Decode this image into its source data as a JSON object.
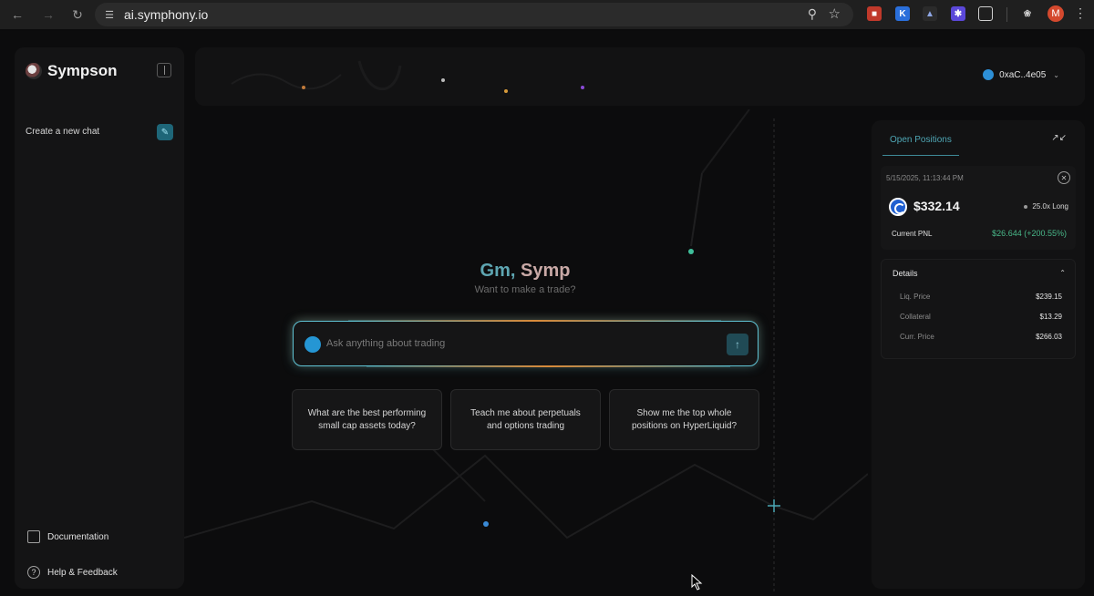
{
  "browser": {
    "url": "ai.symphony.io",
    "profile_initial": "M"
  },
  "sidebar": {
    "brand": "Sympson",
    "new_chat": "Create a new chat",
    "links": [
      {
        "label": "Documentation",
        "icon": "document-icon"
      },
      {
        "label": "Help & Feedback",
        "icon": "help-icon"
      }
    ]
  },
  "header": {
    "wallet_address": "0xaC..4e05"
  },
  "main": {
    "greeting_part1": "Gm,",
    "greeting_part2": "Symp",
    "subtitle": "Want to make a trade?",
    "input_placeholder": "Ask anything about trading",
    "suggestions": [
      "What are the best performing small cap assets today?",
      "Teach me about perpetuals and options trading",
      "Show me the top whole positions on HyperLiquid?"
    ]
  },
  "positions": {
    "tab": "Open Positions",
    "date": "5/15/2025, 11:13:44 PM",
    "price": "$332.14",
    "leverage": "25.0x Long",
    "pnl_label": "Current PNL",
    "pnl_value": "$26.644 (+200.55%)",
    "details_title": "Details",
    "details": [
      {
        "k": "Liq. Price",
        "v": "$239.15"
      },
      {
        "k": "Collateral",
        "v": "$13.29"
      },
      {
        "k": "Curr. Price",
        "v": "$266.03"
      }
    ]
  },
  "colors": {
    "accent_teal": "#5fc3d4",
    "pnl_green": "#49b98a",
    "wallet_blue": "#2d8fd6"
  }
}
